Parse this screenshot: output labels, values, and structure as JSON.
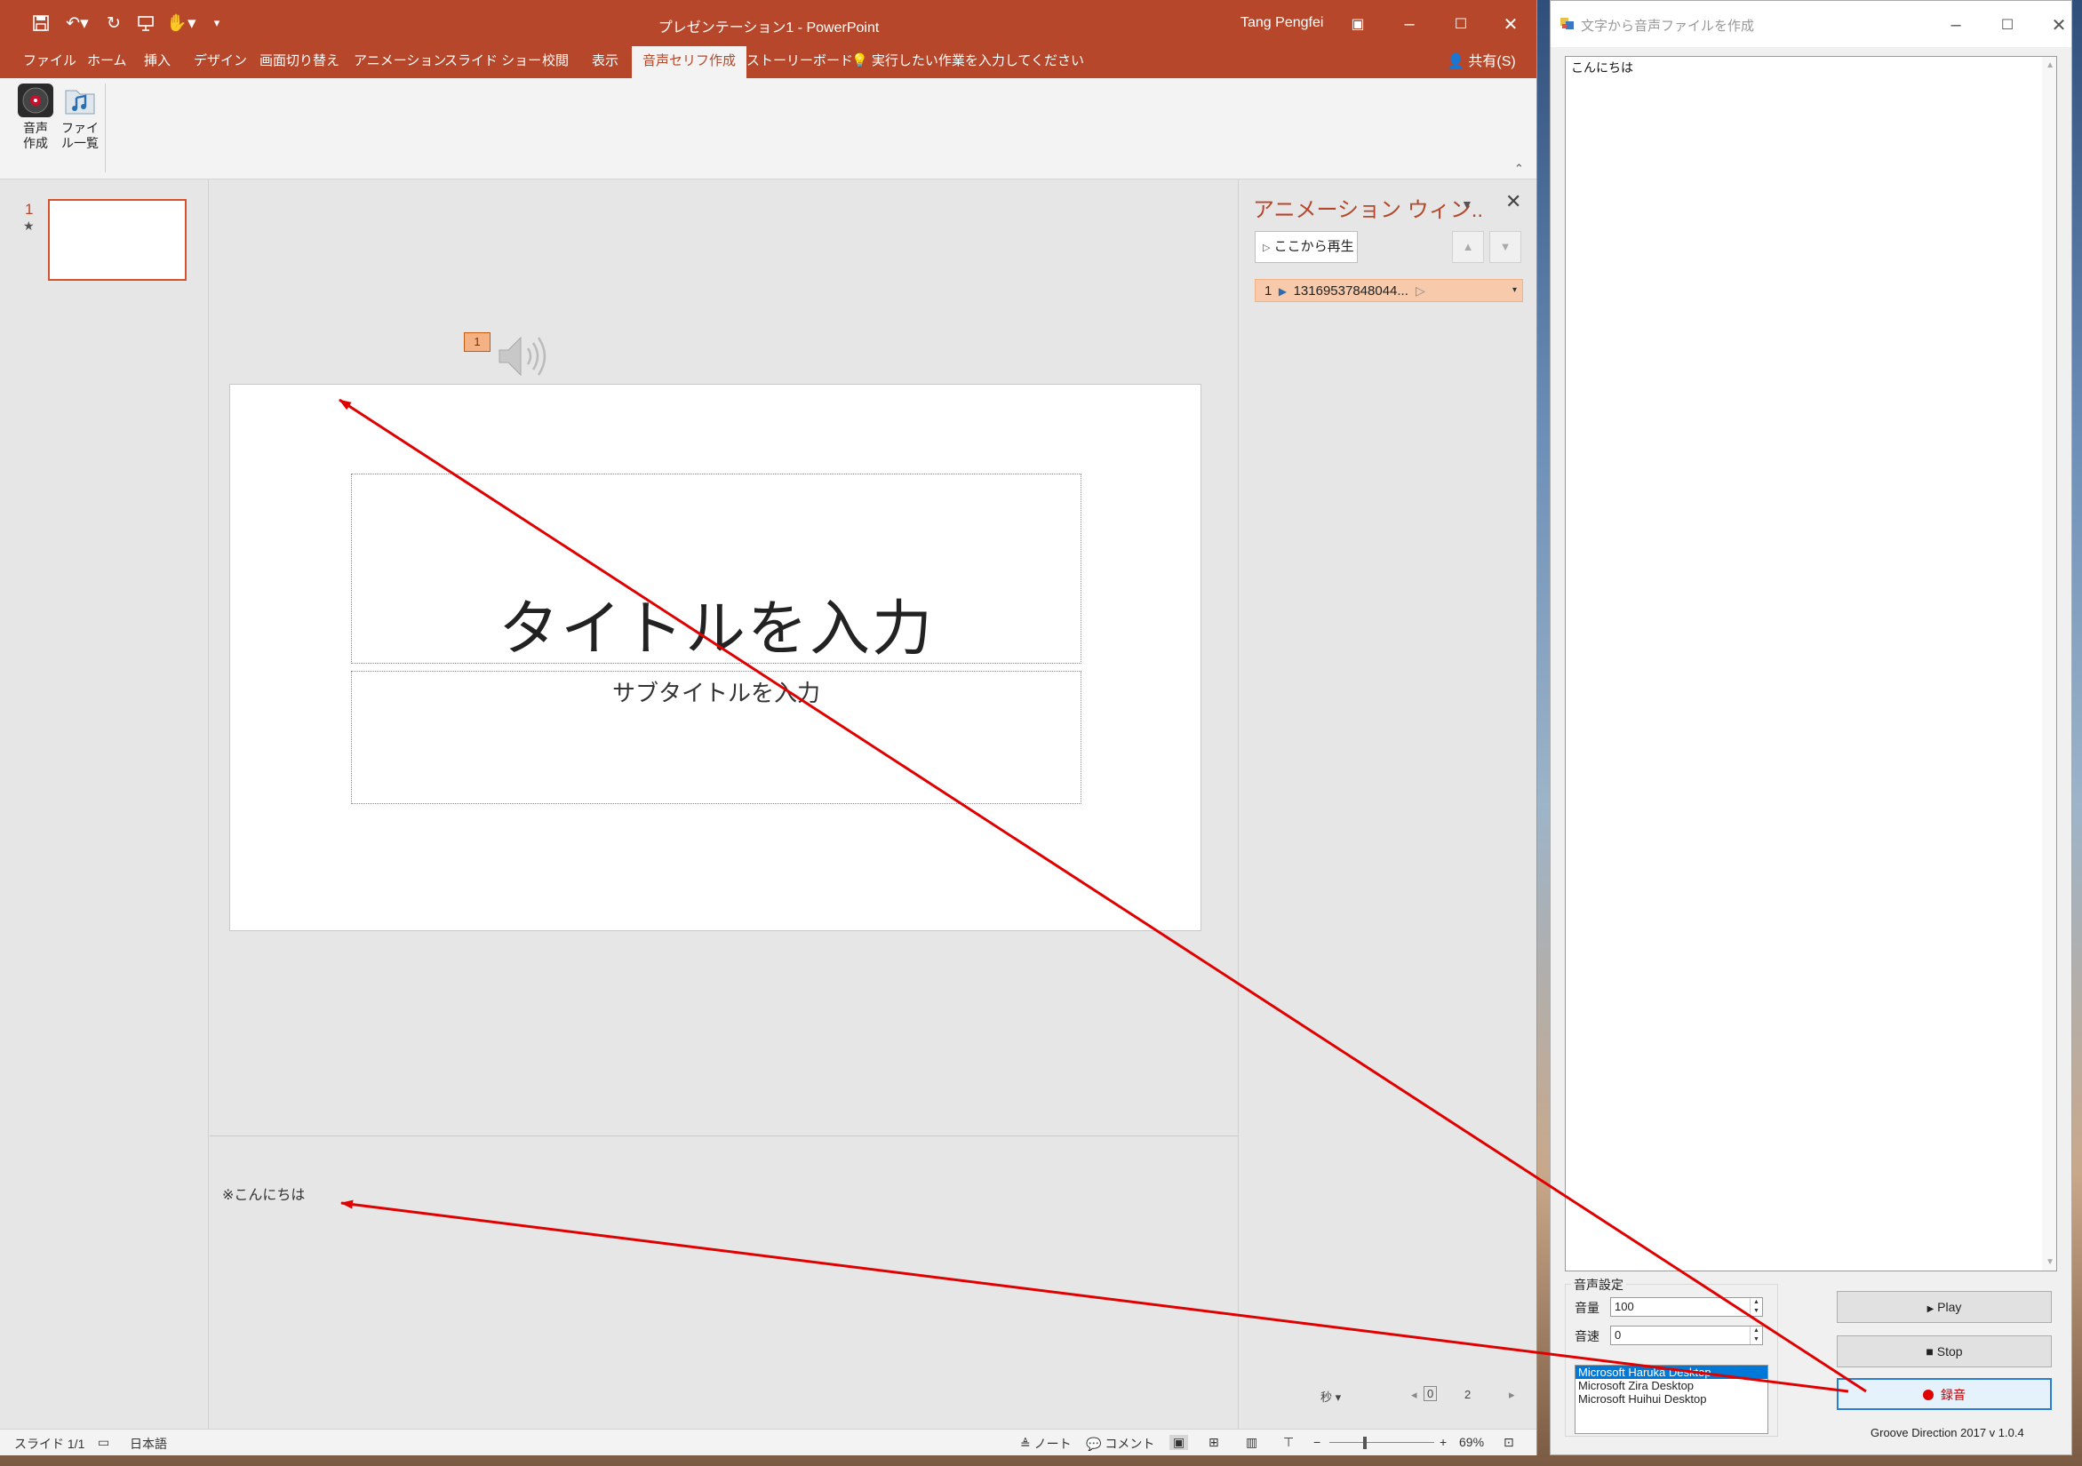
{
  "colors": {
    "ppt_accent": "#b7472a",
    "arrow": "#e00000"
  },
  "ppt": {
    "title": "プレゼンテーション1  -  PowerPoint",
    "user": "Tang Pengfei",
    "tabs": [
      "ファイル",
      "ホーム",
      "挿入",
      "デザイン",
      "画面切り替え",
      "アニメーション",
      "スライド ショー",
      "校閲",
      "表示",
      "音声セリフ作成",
      "ストーリーボード"
    ],
    "active_tab": "音声セリフ作成",
    "tell_me": "実行したい作業を入力してください",
    "share": "共有(S)",
    "ribbon": {
      "voice_create": "音声\n作成",
      "file_list": "ファイ\nル一覧"
    },
    "thumbnail_number": "1",
    "thumbnail_star": "★",
    "anim_tag": "1",
    "slide": {
      "title": "タイトルを入力",
      "subtitle": "サブタイトルを入力"
    },
    "notes": "※こんにちは",
    "anim_pane": {
      "title": "アニメーション ウィン..",
      "play_from": "ここから再生",
      "item_number": "1",
      "item_name": "13169537848044...",
      "unit": "秒",
      "timeline_start": "0",
      "timeline_end": "2"
    },
    "status": {
      "slide": "スライド 1/1",
      "language": "日本語",
      "notes": "ノート",
      "comments": "コメント",
      "zoom": "69%"
    }
  },
  "tts": {
    "title": "文字から音声ファイルを作成",
    "text": "こんにちは",
    "group_label": "音声設定",
    "volume_label": "音量",
    "volume_value": "100",
    "speed_label": "音速",
    "speed_value": "0",
    "voices": [
      "Microsoft Haruka Desktop",
      "Microsoft Zira Desktop",
      "Microsoft Huihui Desktop"
    ],
    "selected_voice": "Microsoft Haruka Desktop",
    "play": "Play",
    "stop": "Stop",
    "record": "録音",
    "version": "Groove Direction 2017 v 1.0.4"
  }
}
